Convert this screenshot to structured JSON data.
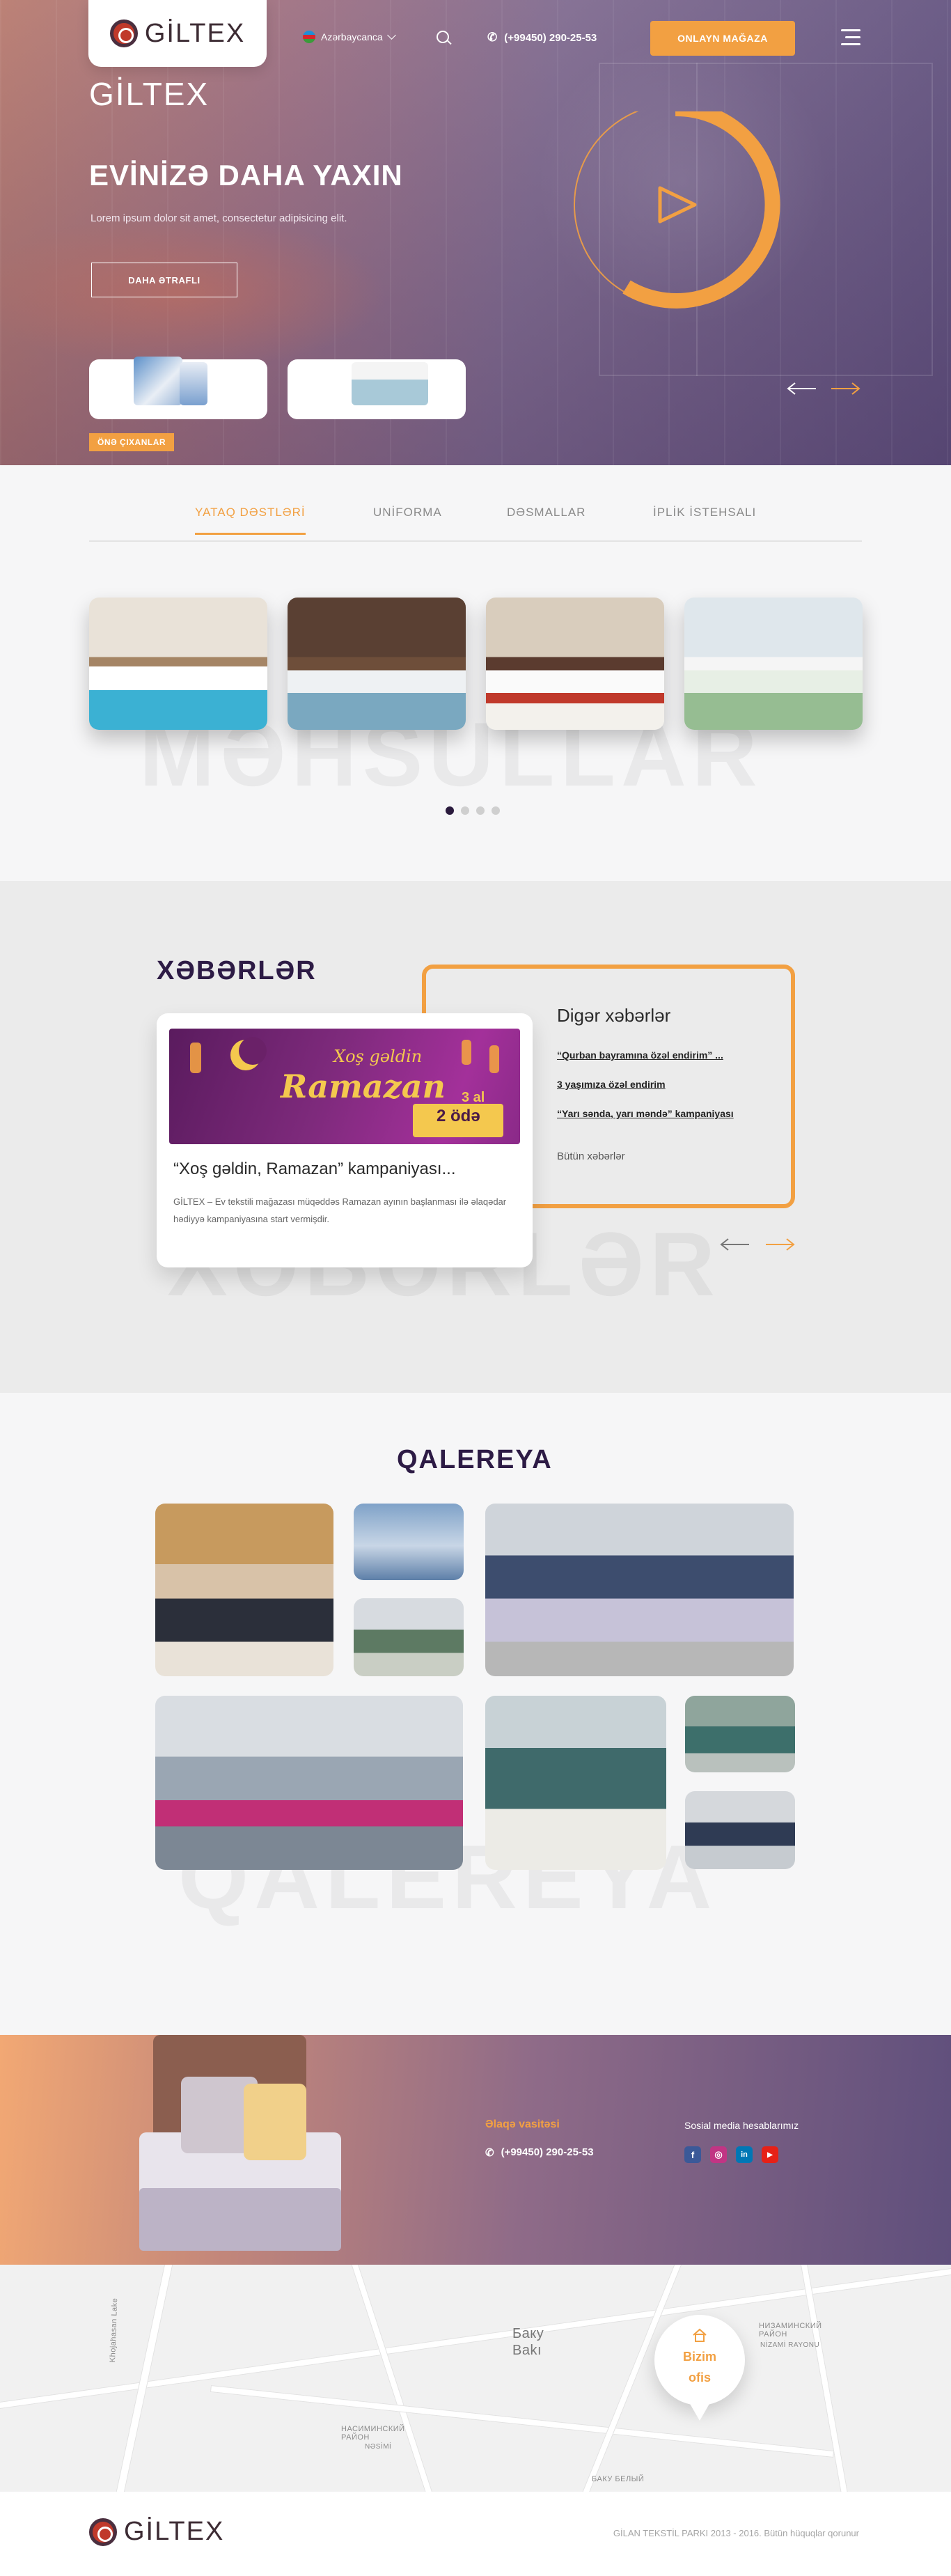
{
  "brand": {
    "name": "GİLTEX"
  },
  "header": {
    "language": "Azərbaycanca",
    "phone": "(+99450) 290-25-53",
    "shop_button": "ONLAYN MAĞAZA"
  },
  "hero": {
    "brand_line": "GİLTEX",
    "title": "EVİNİZƏ DAHA YAXIN",
    "subtitle": "Lorem ipsum dolor sit amet, consectetur adipisicing elit.",
    "more_button": "DAHA ƏTRAFLI",
    "featured_tag": "ÖNƏ ÇIXANLAR"
  },
  "products": {
    "tabs": [
      {
        "label": "YATAQ DƏSTLƏRİ",
        "active": true
      },
      {
        "label": "UNİFORMA",
        "active": false
      },
      {
        "label": "DƏSMALLAR",
        "active": false
      },
      {
        "label": "İPLİK İSTEHSALI",
        "active": false
      }
    ],
    "watermark": "MƏHSULLAR",
    "slider_pages": 4,
    "slider_active": 1
  },
  "news": {
    "title": "XƏBƏRLƏR",
    "watermark": "XƏBƏRLƏR",
    "banner": {
      "line1": "Xoş gəldin",
      "line2": "Ramazan",
      "offer1": "3 al",
      "offer2": "2 ödə"
    },
    "featured_title": "“Xoş gəldin, Ramazan” kampaniyası...",
    "featured_text": "GİLTEX – Ev tekstili mağazası müqəddəs Ramazan ayının başlanması ilə əlaqədar hədiyyə kampaniyasına start vermişdir.",
    "other_title": "Digər xəbərlər",
    "other_links": [
      "“Qurban bayramına özəl endirim” ...",
      "3 yaşımıza özəl endirim",
      "“Yarı sənda, yarı məndə” kampaniyası"
    ],
    "all_news": "Bütün xəbərlər"
  },
  "gallery": {
    "title": "QALEREYA",
    "watermark": "QALEREYA"
  },
  "contact": {
    "title": "Əlaqə vasitəsi",
    "phone": "(+99450) 290-25-53",
    "social_title": "Sosial media hesablarımız",
    "social": [
      {
        "icon": "facebook-icon",
        "glyph": "f",
        "color": "#3b5998"
      },
      {
        "icon": "instagram-icon",
        "glyph": "◎",
        "color": "#c13584"
      },
      {
        "icon": "linkedin-icon",
        "glyph": "in",
        "color": "#0077b5"
      },
      {
        "icon": "youtube-icon",
        "glyph": "▶",
        "color": "#e62117"
      }
    ]
  },
  "map": {
    "pin_label_1": "Bizim",
    "pin_label_2": "ofis",
    "labels": {
      "baku_ru": "Баку",
      "baku_az": "Bakı",
      "nizami": "НИЗАМИНСКИЙ РАЙОН",
      "nizami_az": "NİZAMİ RAYONU",
      "nasimi": "НАСИМИНСКИЙ РАЙОН",
      "nasimi_az": "NƏSİMİ",
      "baku_belyi": "БАКУ БЕЛЫЙ",
      "khojasan": "Khojahasan Lake"
    }
  },
  "footer": {
    "copyright": "GİLAN TEKSTİL PARKI 2013 - 2016. Bütün hüquqlar qorunur"
  },
  "colors": {
    "accent": "#f2a042",
    "dark": "#2d1b45"
  }
}
